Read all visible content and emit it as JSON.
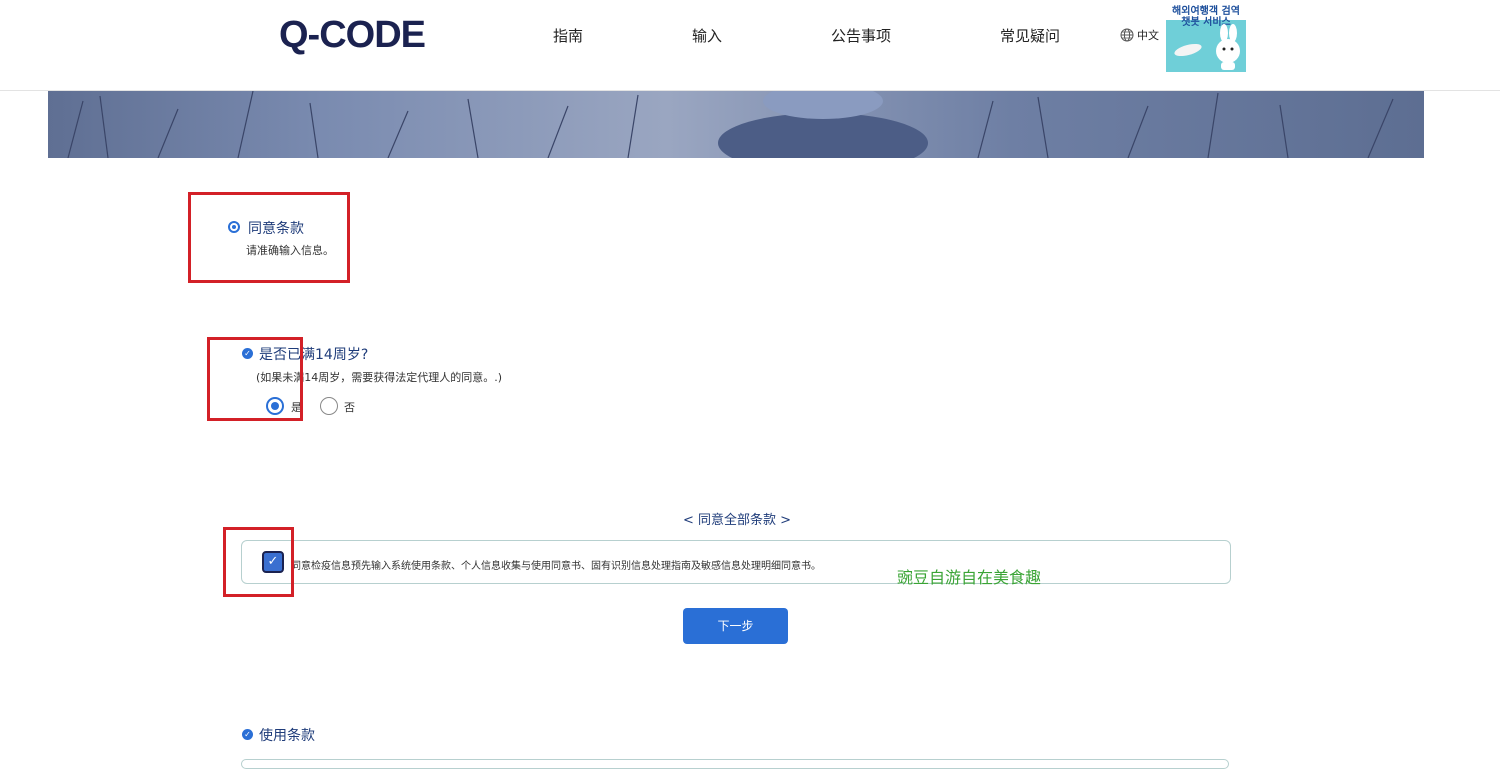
{
  "header": {
    "logo": "Q-CODE",
    "nav": [
      "指南",
      "输入",
      "公告事项",
      "常见疑问"
    ],
    "language": "中文",
    "banner": {
      "line1": "해외여행객 검역",
      "line2": "챗봇 서비스"
    }
  },
  "sections": {
    "terms_agreement": {
      "title": "同意条款",
      "subtitle": "请准确输入信息。"
    },
    "age_check": {
      "question": "是否已满14周岁?",
      "note": "(如果未满14周岁，需要获得法定代理人的同意。.)",
      "options": [
        "是",
        "否"
      ],
      "selected": "是"
    },
    "agree_all": {
      "title": "< 同意全部条款 >",
      "text": "同意检疫信息预先输入系统使用条款、个人信息收集与使用同意书、固有识别信息处理指南及敏感信息处理明细同意书。",
      "checked": true
    },
    "next_button": "下一步",
    "usage_terms_title": "使用条款"
  },
  "watermark": "豌豆自游自在美食趣",
  "colors": {
    "accent": "#2a6fd6",
    "navy": "#1b2250",
    "annotation": "#d32027",
    "watermark": "#3aa435"
  }
}
